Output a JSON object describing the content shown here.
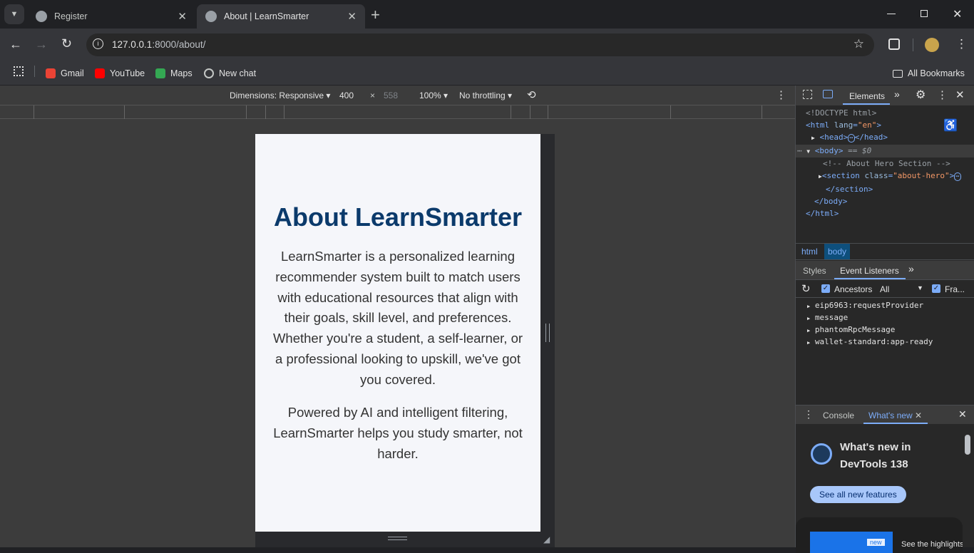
{
  "browser": {
    "tabs": [
      {
        "label": "Register",
        "close": "✕"
      },
      {
        "label": "About | LearnSmarter",
        "close": "✕"
      }
    ],
    "new_tab": "+",
    "url_host": "127.0.0.1",
    "url_path": ":8000/about/",
    "bookmarks": [
      {
        "label": "Gmail",
        "color": "#ea4335"
      },
      {
        "label": "YouTube",
        "color": "#ff0000"
      },
      {
        "label": "Maps",
        "color": "#34a853"
      },
      {
        "label": "New chat",
        "color": "#9aa0a6"
      }
    ],
    "all_bookmarks": "All Bookmarks"
  },
  "device_toolbar": {
    "dimensions": "Dimensions: Responsive",
    "width": "400",
    "height": "558",
    "times": "×",
    "zoom": "100%",
    "throttle": "No throttling"
  },
  "page": {
    "title": "About LearnSmarter",
    "p1": "LearnSmarter is a personalized learning recommender system built to match users with educational resources that align with their goals, skill level, and preferences. Whether you're a student, a self-learner, or a professional looking to upskill, we've got you covered.",
    "p2": "Powered by AI and intelligent filtering, LearnSmarter helps you study smarter, not harder."
  },
  "devtools": {
    "panel": "Elements",
    "tree": {
      "doctype": "<!DOCTYPE html>",
      "html_open": "<html ",
      "lang_attr": "lang",
      "lang_val": "\"en\"",
      "html_close_bracket": ">",
      "head": "<head>",
      "head_close": "</head>",
      "ellipsis": "⋯",
      "body": "<body>",
      "body_eq": " == $0",
      "comment": "<!-- About Hero Section -->",
      "section_open": "<section ",
      "class_attr": "class",
      "class_val": "\"about-hero\"",
      "section_gt": ">",
      "section_close": "</section>",
      "body_close": "</body>",
      "html_close": "</html>"
    },
    "crumbs": [
      "html",
      "body"
    ],
    "subtabs": [
      "Styles",
      "Event Listeners"
    ],
    "ancestors_label": "Ancestors",
    "filter": "All",
    "framework_label": "Fra...",
    "listeners": [
      "eip6963:requestProvider",
      "message",
      "phantomRpcMessage",
      "wallet-standard:app-ready"
    ],
    "drawer_tabs": [
      "Console",
      "What's new"
    ],
    "whats_new_title": "What's new in DevTools 138",
    "see_all": "See all new features",
    "highlight_badge": "new",
    "highlight_text": "See the highlights"
  },
  "colors": {
    "heading": "#0b3a6b",
    "accent": "#7cacf8"
  }
}
